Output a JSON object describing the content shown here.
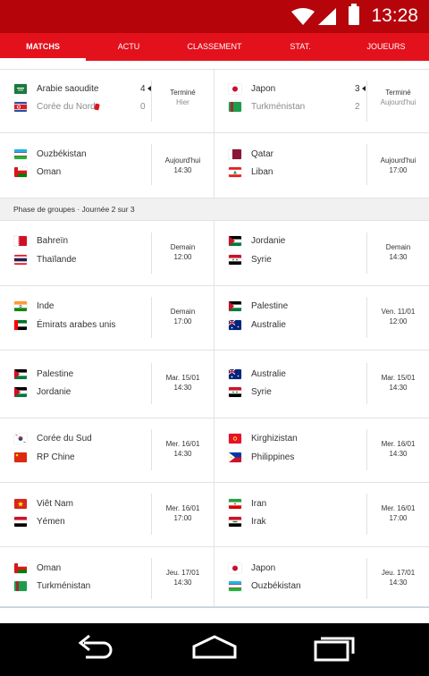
{
  "status_bar": {
    "time": "13:28"
  },
  "tabs": [
    {
      "label": "MATCHS",
      "active": true
    },
    {
      "label": "ACTU",
      "active": false
    },
    {
      "label": "CLASSEMENT",
      "active": false
    },
    {
      "label": "STAT.",
      "active": false
    },
    {
      "label": "JOUEURS",
      "active": false
    }
  ],
  "rows_top": [
    {
      "left": {
        "home": "Arabie saoudite",
        "away": "Corée du Nord",
        "home_score": "4",
        "away_score": "0",
        "status": "Terminé",
        "status_sub": "Hier"
      },
      "right": {
        "home": "Japon",
        "away": "Turkménistan",
        "home_score": "3",
        "away_score": "2",
        "status": "Terminé",
        "status_sub": "Aujourd'hui"
      }
    },
    {
      "left": {
        "home": "Ouzbékistan",
        "away": "Oman",
        "status": "Aujourd'hui",
        "status_sub": "14:30"
      },
      "right": {
        "home": "Qatar",
        "away": "Liban",
        "status": "Aujourd'hui",
        "status_sub": "17:00"
      }
    }
  ],
  "section": {
    "label": "Phase de groupes · Journée 2 sur 3"
  },
  "rows": [
    {
      "left": {
        "home": "Bahreïn",
        "away": "Thaïlande",
        "status": "Demain",
        "status_sub": "12:00"
      },
      "right": {
        "home": "Jordanie",
        "away": "Syrie",
        "status": "Demain",
        "status_sub": "14:30"
      }
    },
    {
      "left": {
        "home": "Inde",
        "away": "Émirats arabes unis",
        "status": "Demain",
        "status_sub": "17:00"
      },
      "right": {
        "home": "Palestine",
        "away": "Australie",
        "status": "Ven. 11/01",
        "status_sub": "12:00"
      }
    },
    {
      "left": {
        "home": "Palestine",
        "away": "Jordanie",
        "status": "Mar. 15/01",
        "status_sub": "14:30"
      },
      "right": {
        "home": "Australie",
        "away": "Syrie",
        "status": "Mar. 15/01",
        "status_sub": "14:30"
      }
    },
    {
      "left": {
        "home": "Corée du Sud",
        "away": "RP Chine",
        "status": "Mer. 16/01",
        "status_sub": "14:30"
      },
      "right": {
        "home": "Kirghizistan",
        "away": "Philippines",
        "status": "Mer. 16/01",
        "status_sub": "14:30"
      }
    },
    {
      "left": {
        "home": "Viêt Nam",
        "away": "Yémen",
        "status": "Mer. 16/01",
        "status_sub": "17:00"
      },
      "right": {
        "home": "Iran",
        "away": "Irak",
        "status": "Mer. 16/01",
        "status_sub": "17:00"
      }
    },
    {
      "left": {
        "home": "Oman",
        "away": "Turkménistan",
        "status": "Jeu. 17/01",
        "status_sub": "14:30"
      },
      "right": {
        "home": "Japon",
        "away": "Ouzbékistan",
        "status": "Jeu. 17/01",
        "status_sub": "14:30"
      }
    }
  ],
  "colors": {
    "status_bar": "#b5040a",
    "tab_bar": "#e3111c",
    "red_card": "#e3111c"
  }
}
